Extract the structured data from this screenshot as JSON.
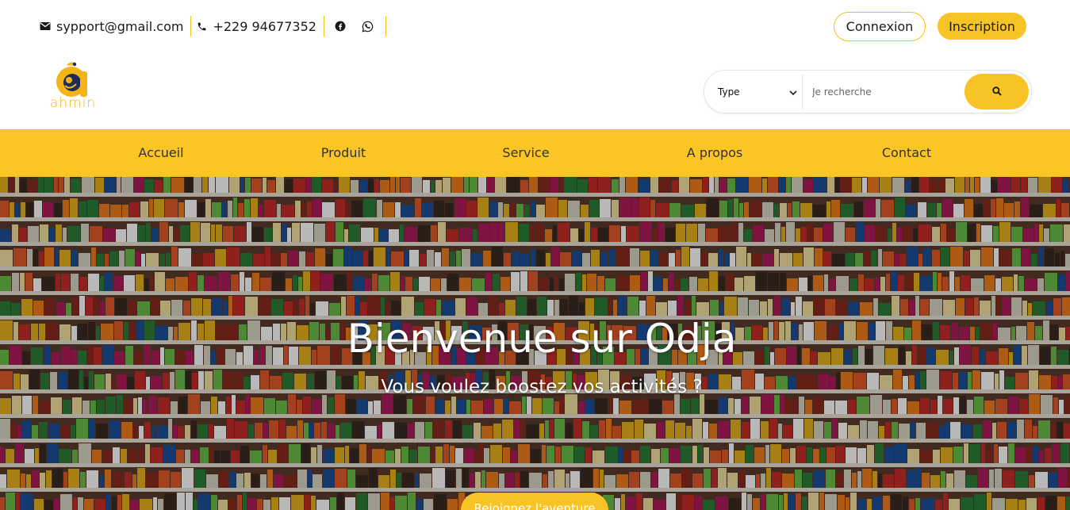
{
  "topbar": {
    "email": "sypport@gmail.com",
    "phone": "+229 94677352",
    "icons": [
      "mail-icon",
      "phone-icon",
      "facebook-icon",
      "whatsapp-icon"
    ],
    "login_label": "Connexion",
    "signup_label": "Inscription"
  },
  "logo": {
    "text": "ahmin"
  },
  "search": {
    "type_selected": "Type",
    "placeholder": "Je recherche",
    "icon": "search-icon"
  },
  "nav": {
    "items": [
      {
        "label": "Accueil"
      },
      {
        "label": "Produit"
      },
      {
        "label": "Service"
      },
      {
        "label": "A propos"
      },
      {
        "label": "Contact"
      }
    ]
  },
  "hero": {
    "title": "Bienvenue sur Odja",
    "subtitle": "Vous voulez boostez vos activités ?",
    "cta_label": "Rejoignez l'aventure"
  },
  "colors": {
    "accent": "#f7c325",
    "nav_bg": "#fbc526",
    "text": "#1a1a1a"
  }
}
